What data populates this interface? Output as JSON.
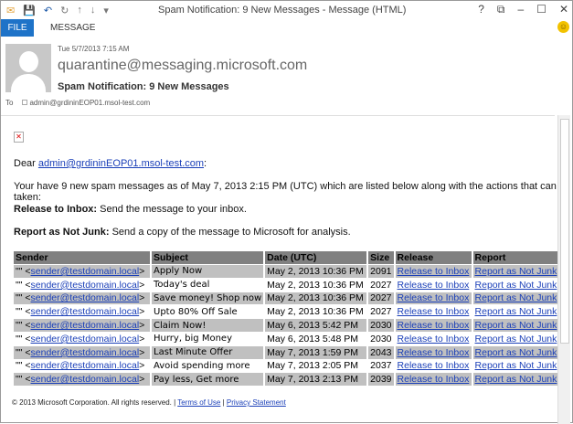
{
  "window": {
    "title": "Spam Notification: 9 New Messages - Message (HTML)",
    "controls": [
      "?",
      "⧉",
      "–",
      "☐",
      "✕"
    ]
  },
  "quick_access": [
    "✉",
    "💾",
    "↶",
    "↻",
    "↑",
    "↓",
    "▾"
  ],
  "ribbon": {
    "tabs": [
      "FILE",
      "MESSAGE"
    ]
  },
  "header": {
    "date": "Tue 5/7/2013 7:15 AM",
    "from": "quarantine@messaging.microsoft.com",
    "subject": "Spam Notification: 9 New Messages",
    "to_label": "To",
    "to": "admin@grdininEOP01.msol-test.com"
  },
  "body": {
    "broken_image": "✕",
    "dear": "Dear ",
    "dear_link": "admin@grdininEOP01.msol-test.com",
    "dear_end": ":",
    "intro": "Your have 9 new spam messages as of May 7, 2013 2:15 PM (UTC) which are listed below along with the actions that can be taken:",
    "release_label": "Release to Inbox:",
    "release_text": " Send the message to your inbox.",
    "report_label": "Report as Not Junk:",
    "report_text": " Send a copy of the message to Microsoft for analysis."
  },
  "table": {
    "headers": [
      "Sender",
      "Subject",
      "Date (UTC)",
      "Size",
      "Release",
      "Report"
    ],
    "rows": [
      {
        "sender_prefix": "\"\" <",
        "sender": "sender@testdomain.local",
        "sender_suffix": ">",
        "subject": " Apply Now",
        "date": "May 2, 2013 10:36 PM",
        "size": "2091",
        "release": "Release to Inbox",
        "report": "Report as Not Junk"
      },
      {
        "sender_prefix": "\"\" <",
        "sender": "sender@testdomain.local",
        "sender_suffix": ">",
        "subject": "Today's deal",
        "date": "May 2, 2013 10:36 PM",
        "size": "2027",
        "release": "Release to Inbox",
        "report": "Report as Not Junk"
      },
      {
        "sender_prefix": "\"\" <",
        "sender": "sender@testdomain.local",
        "sender_suffix": ">",
        "subject": "Save money! Shop now",
        "date": "May 2, 2013 10:36 PM",
        "size": "2027",
        "release": "Release to Inbox",
        "report": "Report as Not Junk"
      },
      {
        "sender_prefix": "\"\" <",
        "sender": "sender@testdomain.local",
        "sender_suffix": ">",
        "subject": "Upto 80% Off Sale",
        "date": "May 2, 2013 10:36 PM",
        "size": "2027",
        "release": "Release to Inbox",
        "report": "Report as Not Junk"
      },
      {
        "sender_prefix": "\"\" <",
        "sender": "sender@testdomain.local",
        "sender_suffix": ">",
        "subject": "Claim Now!",
        "date": "May 6, 2013 5:42 PM",
        "size": "2030",
        "release": "Release to Inbox",
        "report": "Report as Not Junk"
      },
      {
        "sender_prefix": "\"\" <",
        "sender": "sender@testdomain.local",
        "sender_suffix": ">",
        "subject": " Hurry, big Money",
        "date": "May 6, 2013 5:48 PM",
        "size": "2030",
        "release": "Release to Inbox",
        "report": "Report as Not Junk"
      },
      {
        "sender_prefix": "\"\" <",
        "sender": "sender@testdomain.local",
        "sender_suffix": ">",
        "subject": "Last Minute Offer",
        "date": "May 7, 2013 1:59 PM",
        "size": "2043",
        "release": "Release to Inbox",
        "report": "Report as Not Junk"
      },
      {
        "sender_prefix": "\"\" <",
        "sender": "sender@testdomain.local",
        "sender_suffix": ">",
        "subject": "Avoid  spending more",
        "date": "May 7, 2013 2:05 PM",
        "size": "2037",
        "release": "Release to Inbox",
        "report": "Report as Not Junk"
      },
      {
        "sender_prefix": "\"\" <",
        "sender": "sender@testdomain.local",
        "sender_suffix": ">",
        "subject": "Pay less, Get more",
        "date": "May 7, 2013 2:13 PM",
        "size": "2039",
        "release": "Release to Inbox",
        "report": "Report as Not Junk"
      }
    ]
  },
  "footer": {
    "copyright": "© 2013 Microsoft Corporation. All rights reserved. | ",
    "terms": "Terms of Use",
    "sep": " | ",
    "privacy": "Privacy Statement"
  },
  "colors": {
    "file_tab": "#1e73c8",
    "header_row": "#808080",
    "shaded_row": "#c0c0c0",
    "link": "#1a3fb8"
  }
}
